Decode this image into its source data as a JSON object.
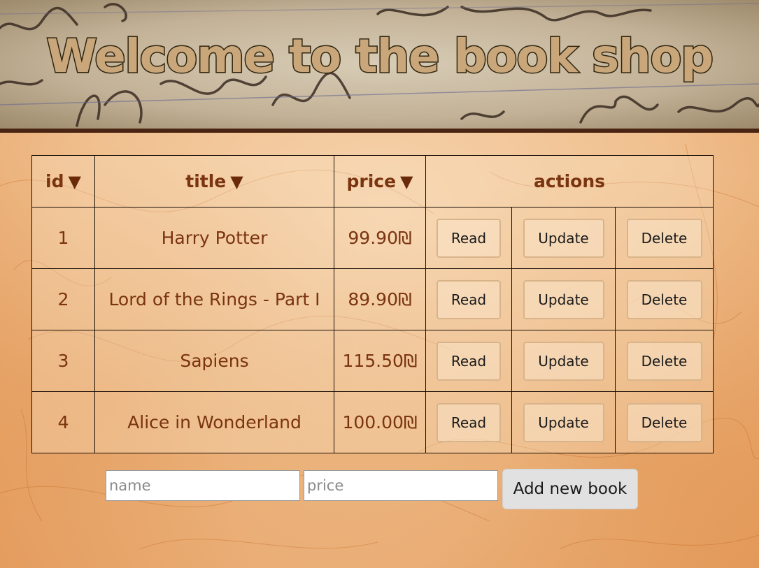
{
  "header": {
    "title": "Welcome to the book shop"
  },
  "table": {
    "columns": [
      {
        "label": "id",
        "sortable": true,
        "sort_icon": "triangle-down-icon"
      },
      {
        "label": "title",
        "sortable": true,
        "sort_icon": "triangle-down-icon"
      },
      {
        "label": "price",
        "sortable": true,
        "sort_icon": "triangle-down-icon"
      },
      {
        "label": "actions",
        "sortable": false
      }
    ],
    "sort_arrow": "▼",
    "rows": [
      {
        "id": "1",
        "title": "Harry Potter",
        "price": "99.90₪"
      },
      {
        "id": "2",
        "title": "Lord of the Rings - Part I",
        "price": "89.90₪"
      },
      {
        "id": "3",
        "title": "Sapiens",
        "price": "115.50₪"
      },
      {
        "id": "4",
        "title": "Alice in Wonderland",
        "price": "100.00₪"
      }
    ],
    "actions": {
      "read": "Read",
      "update": "Update",
      "delete": "Delete"
    }
  },
  "form": {
    "name_placeholder": "name",
    "price_placeholder": "price",
    "name_value": "",
    "price_value": "",
    "add_button_label": "Add new book"
  },
  "colors": {
    "text_brown": "#7a3410",
    "header_border": "#4a2412",
    "title_fill": "#c9a77a",
    "title_stroke": "#2f2510"
  }
}
